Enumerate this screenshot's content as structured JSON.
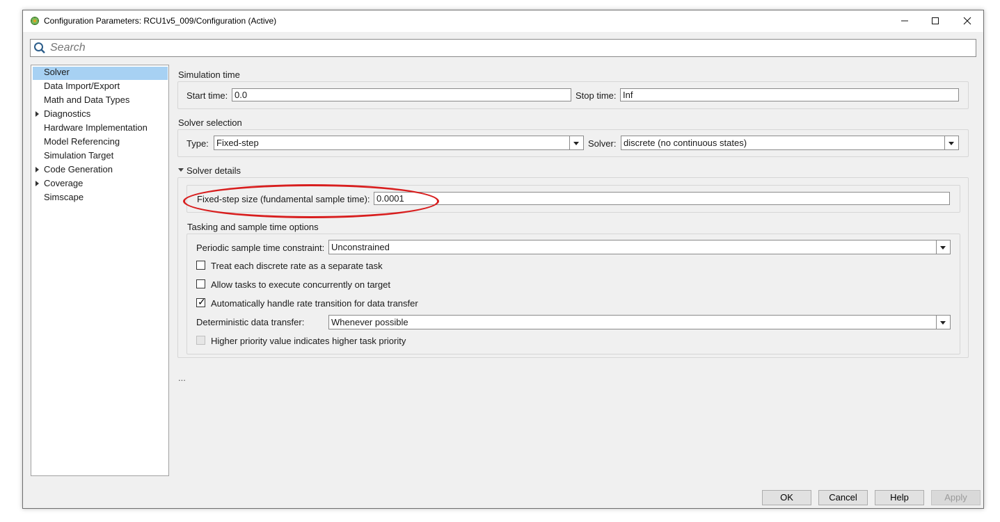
{
  "window": {
    "title": "Configuration Parameters: RCU1v5_009/Configuration (Active)",
    "controls": {
      "minimize": "—",
      "maximize": "☐",
      "close": "✕"
    }
  },
  "search": {
    "placeholder": "Search"
  },
  "tree": {
    "items": [
      {
        "label": "Solver",
        "selected": true,
        "expandable": false
      },
      {
        "label": "Data Import/Export",
        "selected": false,
        "expandable": false
      },
      {
        "label": "Math and Data Types",
        "selected": false,
        "expandable": false
      },
      {
        "label": "Diagnostics",
        "selected": false,
        "expandable": true
      },
      {
        "label": "Hardware Implementation",
        "selected": false,
        "expandable": false
      },
      {
        "label": "Model Referencing",
        "selected": false,
        "expandable": false
      },
      {
        "label": "Simulation Target",
        "selected": false,
        "expandable": false
      },
      {
        "label": "Code Generation",
        "selected": false,
        "expandable": true
      },
      {
        "label": "Coverage",
        "selected": false,
        "expandable": true
      },
      {
        "label": "Simscape",
        "selected": false,
        "expandable": false
      }
    ]
  },
  "simulation_time": {
    "title": "Simulation time",
    "start_label": "Start time:",
    "start_value": "0.0",
    "stop_label": "Stop time:",
    "stop_value": "Inf"
  },
  "solver_selection": {
    "title": "Solver selection",
    "type_label": "Type:",
    "type_value": "Fixed-step",
    "solver_label": "Solver:",
    "solver_value": "discrete (no continuous states)"
  },
  "solver_details": {
    "title": "Solver details",
    "fixed_step_label": "Fixed-step size (fundamental sample time):",
    "fixed_step_value": "0.0001"
  },
  "tasking": {
    "title": "Tasking and sample time options",
    "periodic_label": "Periodic sample time constraint:",
    "periodic_value": "Unconstrained",
    "cb_separate_task": {
      "label": "Treat each discrete rate as a separate task",
      "checked": false
    },
    "cb_concurrent": {
      "label": "Allow tasks to execute concurrently on target",
      "checked": false
    },
    "cb_rate_transition": {
      "label": "Automatically handle rate transition for data transfer",
      "checked": true
    },
    "deterministic_label": "Deterministic data transfer:",
    "deterministic_value": "Whenever possible",
    "cb_priority": {
      "label": "Higher priority value indicates higher task priority",
      "checked": false,
      "disabled": true
    }
  },
  "more_indicator": "...",
  "buttons": {
    "ok": "OK",
    "cancel": "Cancel",
    "help": "Help",
    "apply": "Apply"
  },
  "annotation": {
    "color": "#d81e1e"
  }
}
